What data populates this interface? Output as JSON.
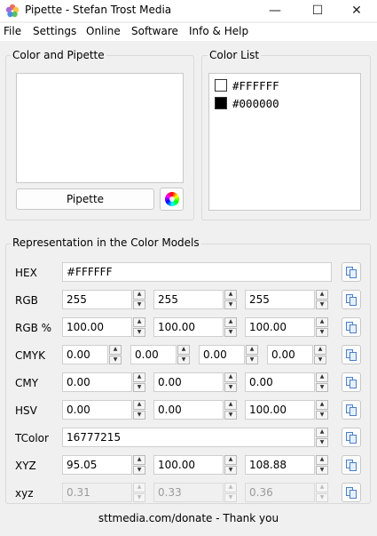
{
  "titlebar": {
    "title": "Pipette - Stefan Trost Media",
    "minimize": "—",
    "maximize": "☐",
    "close": "✕"
  },
  "menu": [
    "File",
    "Settings",
    "Online",
    "Software",
    "Info & Help"
  ],
  "color_pipette": {
    "title": "Color and Pipette",
    "pipette_label": "Pipette"
  },
  "color_list": {
    "title": "Color List",
    "items": [
      {
        "hex": "#FFFFFF",
        "color": "#FFFFFF"
      },
      {
        "hex": "#000000",
        "color": "#000000"
      }
    ]
  },
  "models": {
    "title": "Representation in the Color Models",
    "hex": {
      "label": "HEX",
      "value": "#FFFFFF"
    },
    "rgb": {
      "label": "RGB",
      "values": [
        "255",
        "255",
        "255"
      ]
    },
    "rgb_pct": {
      "label": "RGB %",
      "values": [
        "100.00",
        "100.00",
        "100.00"
      ]
    },
    "cmyk": {
      "label": "CMYK",
      "values": [
        "0.00",
        "0.00",
        "0.00",
        "0.00"
      ]
    },
    "cmy": {
      "label": "CMY",
      "values": [
        "0.00",
        "0.00",
        "0.00"
      ]
    },
    "hsv": {
      "label": "HSV",
      "values": [
        "0.00",
        "0.00",
        "100.00"
      ]
    },
    "tcolor": {
      "label": "TColor",
      "value": "16777215"
    },
    "xyz": {
      "label": "XYZ",
      "values": [
        "95.05",
        "100.00",
        "108.88"
      ]
    },
    "xyz_small": {
      "label": "xyz",
      "values": [
        "0.31",
        "0.33",
        "0.36"
      ]
    }
  },
  "footer": "sttmedia.com/donate - Thank you",
  "icons": {
    "app": "pipette-app-icon",
    "copy": "copy-icon",
    "color_wheel": "color-wheel-icon"
  }
}
